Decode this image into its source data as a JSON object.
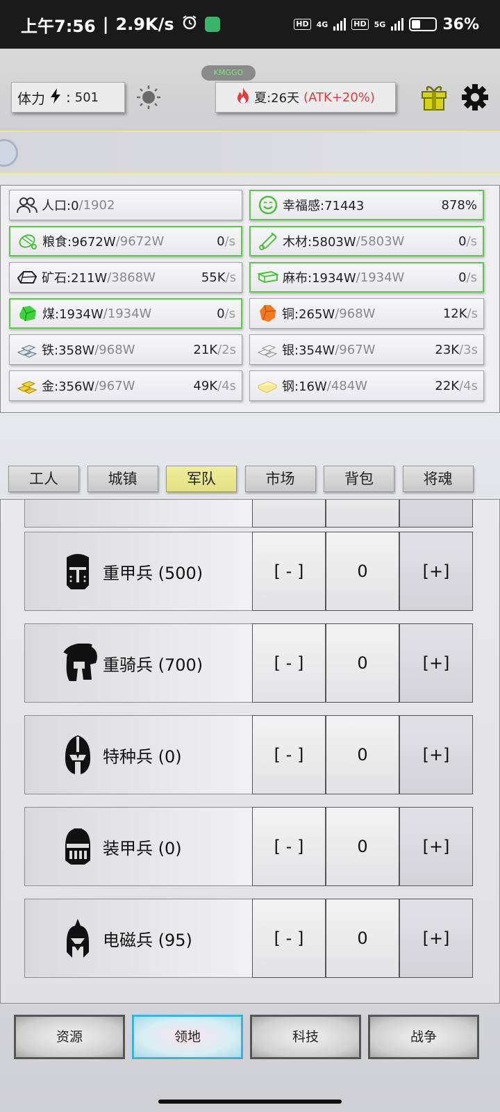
{
  "status_bar": {
    "time": "上午7:56",
    "speed": "2.9K/s",
    "net1": "4G",
    "net2": "5G",
    "chip": "HD",
    "battery": "36%"
  },
  "top": {
    "pill": "KMGGO",
    "stamina_label": "体力",
    "stamina_sep": ":",
    "stamina_value": "501",
    "season_text": "夏:26天",
    "season_bonus": "(ATK+20%)"
  },
  "resources": [
    {
      "name": "人口:0",
      "max": "/1902",
      "rate": "",
      "per": "",
      "icon": "population-icon",
      "green": false
    },
    {
      "name": "幸福感:71443",
      "max": "",
      "rate": "878%",
      "per": "",
      "icon": "smile-icon",
      "green": true
    },
    {
      "name": "粮食:9672W",
      "max": "/9672W",
      "rate": "0",
      "per": "/s",
      "icon": "food-icon",
      "green": true
    },
    {
      "name": "木材:5803W",
      "max": "/5803W",
      "rate": "0",
      "per": "/s",
      "icon": "wood-icon",
      "green": true
    },
    {
      "name": "矿石:211W",
      "max": "/3868W",
      "rate": "55K",
      "per": "/s",
      "icon": "ore-icon",
      "green": false
    },
    {
      "name": "麻布:1934W",
      "max": "/1934W",
      "rate": "0",
      "per": "/s",
      "icon": "linen-icon",
      "green": true
    },
    {
      "name": "煤:1934W",
      "max": "/1934W",
      "rate": "0",
      "per": "/s",
      "icon": "coal-icon",
      "green": true
    },
    {
      "name": "铜:265W",
      "max": "/968W",
      "rate": "12K",
      "per": "/s",
      "icon": "copper-icon",
      "green": false
    },
    {
      "name": "铁:358W",
      "max": "/968W",
      "rate": "21K",
      "per": "/2s",
      "icon": "iron-icon",
      "green": false
    },
    {
      "name": "银:354W",
      "max": "/967W",
      "rate": "23K",
      "per": "/3s",
      "icon": "silver-icon",
      "green": false
    },
    {
      "name": "金:356W",
      "max": "/967W",
      "rate": "49K",
      "per": "/4s",
      "icon": "gold-icon",
      "green": false
    },
    {
      "name": "钢:16W",
      "max": "/484W",
      "rate": "22K",
      "per": "/4s",
      "icon": "steel-icon",
      "green": false
    }
  ],
  "tabs": [
    "工人",
    "城镇",
    "军队",
    "市场",
    "背包",
    "将魂"
  ],
  "active_tab": "军队",
  "troops": [
    {
      "label": "重甲兵 (500)",
      "minus": "[ - ]",
      "count": "0",
      "plus": "[+]",
      "icon": "great-helm-icon"
    },
    {
      "label": "重骑兵 (700)",
      "minus": "[ - ]",
      "count": "0",
      "plus": "[+]",
      "icon": "crested-helm-icon"
    },
    {
      "label": "特种兵 (0)",
      "minus": "[ - ]",
      "count": "0",
      "plus": "[+]",
      "icon": "spartan-helm-icon"
    },
    {
      "label": "装甲兵 (0)",
      "minus": "[ - ]",
      "count": "0",
      "plus": "[+]",
      "icon": "barbute-helm-icon"
    },
    {
      "label": "电磁兵 (95)",
      "minus": "[ - ]",
      "count": "0",
      "plus": "[+]",
      "icon": "plumed-helm-icon"
    }
  ],
  "bottom_nav": [
    "资源",
    "领地",
    "科技",
    "战争"
  ],
  "active_nav": "领地",
  "colors": {
    "accent_green": "#5fc94f",
    "active_tab": "#e8e58a",
    "active_nav_border": "#3cb2d9",
    "atk_red": "#e23b3b"
  }
}
